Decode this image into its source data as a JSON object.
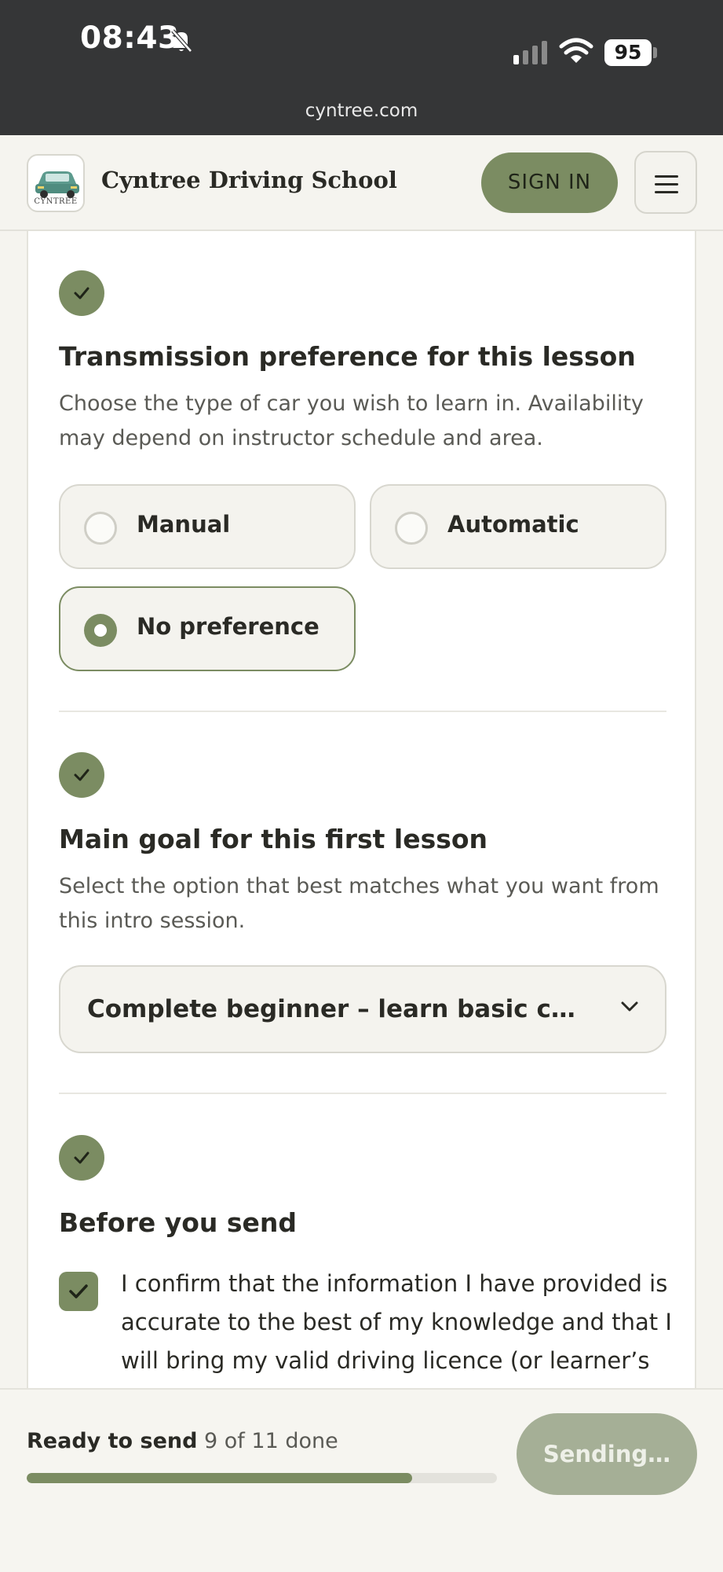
{
  "status_bar": {
    "time": "08:43",
    "battery": "95",
    "url": "cyntree.com"
  },
  "header": {
    "logo_text": "CYNTREE",
    "brand": "Cyntree Driving School",
    "sign_in": "SIGN IN"
  },
  "transmission": {
    "title": "Transmission preference for this lesson",
    "description": "Choose the type of car you wish to learn in. Availability may depend on instructor schedule and area.",
    "options": [
      {
        "label": "Manual",
        "selected": false
      },
      {
        "label": "Automatic",
        "selected": false
      },
      {
        "label": "No preference",
        "selected": true
      }
    ]
  },
  "goal": {
    "title": "Main goal for this first lesson",
    "description": "Select the option that best matches what you want from this intro session.",
    "selected_value": "Complete beginner – learn basic cont..."
  },
  "consent": {
    "title": "Before you send",
    "checked": true,
    "text": "I confirm that the information I have provided is accurate to the best of my knowledge and that I will bring my valid driving licence (or learner’s"
  },
  "footer": {
    "ready_label": "Ready to send",
    "progress_text": "9 of 11 done",
    "progress_fraction": 0.82,
    "send_button": "Sending…"
  },
  "colors": {
    "accent": "#7b8c62",
    "status_bar": "#353637",
    "background": "#f5f4ef"
  }
}
